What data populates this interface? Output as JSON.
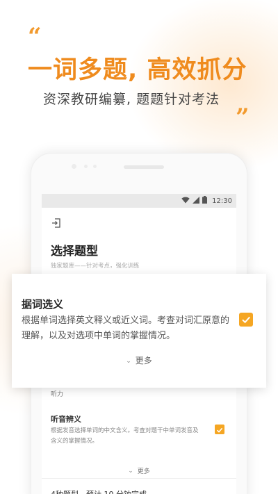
{
  "promo": {
    "quote_open": "“",
    "quote_close": "”",
    "headline": "一词多题, 高效抓分",
    "subheadline": "资深教研编纂, 题题针对考法"
  },
  "status_bar": {
    "time": "12:30",
    "icons": [
      "wifi-icon",
      "signal-icon",
      "battery-icon"
    ]
  },
  "screen": {
    "back_icon": "exit-icon",
    "title": "选择题型",
    "description": "独家题库——针对考点，强化训练",
    "section_label": "听力",
    "item2": {
      "title": "听音辨义",
      "description": "根据发音选择单词的中文含义。考查对题干中单词发音及含义的掌握情况。",
      "checked": true,
      "more_label": "更多"
    },
    "footer_text": "4种题型，预计 10 分钟完成"
  },
  "card": {
    "title": "据词选义",
    "description": "根据单词选择英文释义或近义词。考查对词汇原意的理解，以及对选项中单词的掌握情况。",
    "checked": true,
    "more_label": "更多"
  },
  "colors": {
    "accent": "#ef8b1e",
    "check": "#f5a623"
  }
}
